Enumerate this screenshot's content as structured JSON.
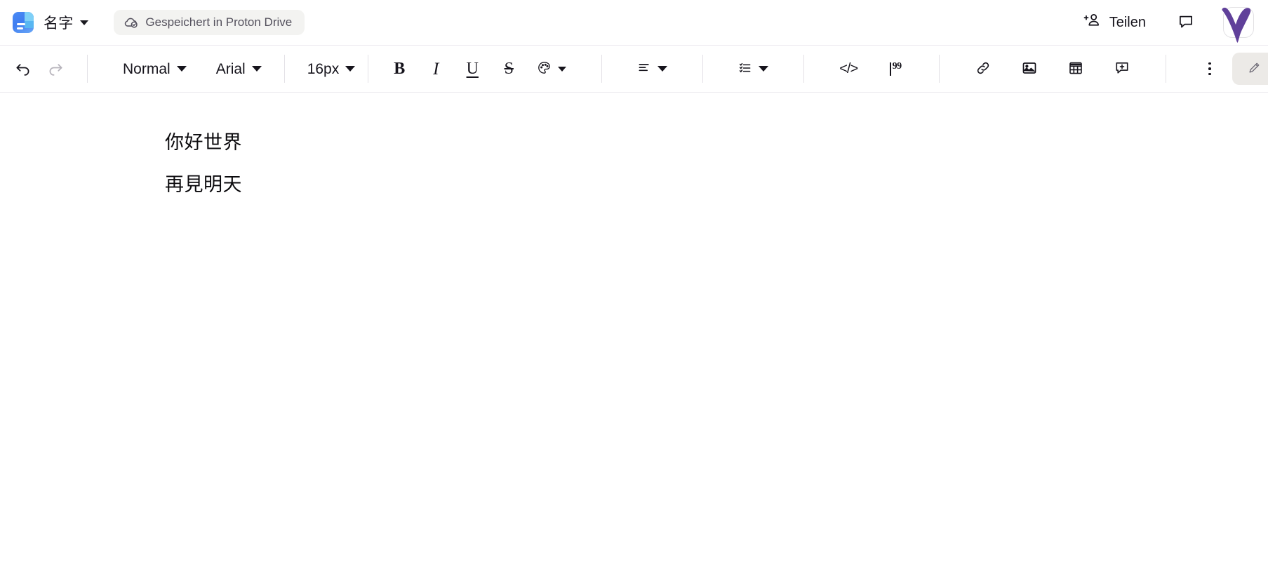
{
  "app": {
    "icon_name": "proton-docs-app-icon",
    "accent_blue": "#4b8bf5",
    "accent_purple": "#6d4aa0"
  },
  "topbar": {
    "document_title": "名字",
    "title_caret_icon": "chevron-down-icon",
    "save_status": {
      "icon": "cloud-check-icon",
      "label": "Gespeichert in Proton Drive"
    },
    "share": {
      "icon": "person-add-icon",
      "label": "Teilen"
    },
    "comments_icon": "comment-bubble-icon",
    "avatar": {
      "name": "user-avatar",
      "mark": "purple-v-mark"
    }
  },
  "toolbar": {
    "undo": {
      "icon": "undo-arrow-icon",
      "label": "Rückgängig",
      "enabled": true
    },
    "redo": {
      "icon": "redo-arrow-icon",
      "label": "Wiederholen",
      "enabled": false
    },
    "paragraph_style": {
      "value": "Normal",
      "caret": "chevron-down-icon"
    },
    "font_family": {
      "value": "Arial",
      "caret": "chevron-down-icon"
    },
    "font_size": {
      "value": "16px",
      "caret": "chevron-down-icon"
    },
    "bold": {
      "glyph": "B",
      "name": "bold-button"
    },
    "italic": {
      "glyph": "I",
      "name": "italic-button"
    },
    "underline": {
      "glyph": "U",
      "name": "underline-button"
    },
    "strikethrough": {
      "glyph": "S",
      "name": "strikethrough-button"
    },
    "text_color": {
      "icon": "color-palette-icon",
      "caret": "chevron-down-icon"
    },
    "align": {
      "icon": "align-left-icon",
      "caret": "chevron-down-icon"
    },
    "list": {
      "icon": "bulleted-list-icon",
      "caret": "chevron-down-icon"
    },
    "code": {
      "glyph": "</>",
      "name": "code-block-button"
    },
    "quote": {
      "glyph": "99",
      "name": "block-quote-button"
    },
    "link": {
      "icon": "link-chain-icon"
    },
    "image": {
      "icon": "image-icon"
    },
    "table": {
      "icon": "table-grid-icon"
    },
    "add_comment": {
      "icon": "comment-plus-icon"
    },
    "more": {
      "icon": "kebab-more-icon"
    },
    "mode": {
      "icon": "pencil-edit-icon",
      "caret": "chevron-down-icon",
      "value": "Bearbeiten"
    }
  },
  "document": {
    "paragraphs": [
      "你好世界",
      "再見明天"
    ]
  }
}
